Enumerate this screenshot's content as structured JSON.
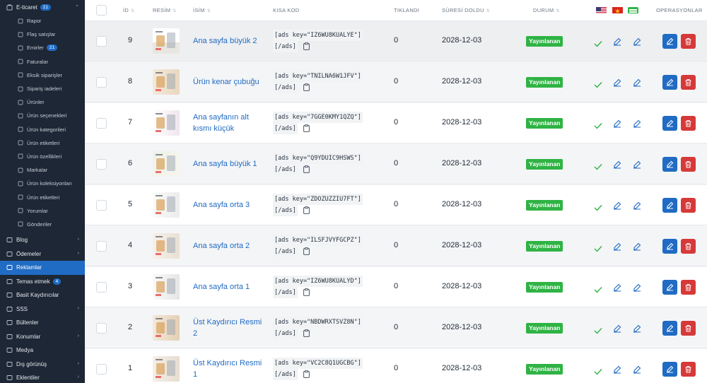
{
  "sidebar": {
    "top": {
      "label": "E-ticaret",
      "badge": "21"
    },
    "children": [
      {
        "label": "Rapor",
        "icon": "report-icon"
      },
      {
        "label": "Flaş satışlar",
        "icon": "flash-icon"
      },
      {
        "label": "Emirler",
        "icon": "orders-icon",
        "badge": "21"
      },
      {
        "label": "Faturalar",
        "icon": "invoice-icon"
      },
      {
        "label": "Eksik siparişler",
        "icon": "cart-icon"
      },
      {
        "label": "Sipariş iadeleri",
        "icon": "return-icon"
      },
      {
        "label": "Ürünler",
        "icon": "box-icon"
      },
      {
        "label": "Ürün seçenekleri",
        "icon": "options-icon"
      },
      {
        "label": "Ürün kategorileri",
        "icon": "category-icon"
      },
      {
        "label": "Ürün etiketleri",
        "icon": "tag-icon"
      },
      {
        "label": "Ürün özellikleri",
        "icon": "attributes-icon"
      },
      {
        "label": "Markalar",
        "icon": "brand-icon"
      },
      {
        "label": "Ürün koleksiyonları",
        "icon": "collection-icon"
      },
      {
        "label": "Ürün etiketleri",
        "icon": "label-icon"
      },
      {
        "label": "Yorumlar",
        "icon": "star-icon"
      },
      {
        "label": "Gönderiler",
        "icon": "shipment-icon"
      }
    ],
    "parents": [
      {
        "label": "Blog",
        "icon": "blog-icon",
        "chevron": "›"
      },
      {
        "label": "Ödemeler",
        "icon": "payment-icon",
        "chevron": "›"
      },
      {
        "label": "Reklamlar",
        "icon": "ads-icon",
        "chevron": "",
        "active": true
      },
      {
        "label": "Temas etmek",
        "icon": "mail-icon",
        "badge": "4",
        "chevron": ""
      },
      {
        "label": "Basit Kaydırıcılar",
        "icon": "slider-icon",
        "chevron": ""
      },
      {
        "label": "SSS",
        "icon": "faq-icon",
        "chevron": "›"
      },
      {
        "label": "Bültenler",
        "icon": "newsletter-icon",
        "chevron": ""
      },
      {
        "label": "Konumlar",
        "icon": "location-icon",
        "chevron": "›"
      },
      {
        "label": "Medya",
        "icon": "folder-icon",
        "chevron": ""
      },
      {
        "label": "Dış görünüş",
        "icon": "appearance-icon",
        "chevron": "›"
      },
      {
        "label": "Eklentiler",
        "icon": "plugin-icon",
        "chevron": "›"
      }
    ]
  },
  "table": {
    "headers": {
      "id": "İD",
      "image": "RESİM",
      "name": "İSİM",
      "shortcode": "KISA KOD",
      "clicked": "TIKLANDI",
      "expired": "SÜRESİ DOLDU",
      "status": "DURUM",
      "operations": "OPERASYONLAR"
    },
    "flags": [
      "us-flag-icon",
      "vn-flag-icon",
      "language-badge-icon"
    ],
    "code_close": "[/ads]",
    "rows": [
      {
        "id": "9",
        "name": "Ana sayfa büyük 2",
        "code": "[ads key=\"IZ6WU8KUALYE\"]",
        "clicked": "0",
        "expired": "2028-12-03",
        "status": "Yayınlanan"
      },
      {
        "id": "8",
        "name": "Ürün kenar çubuğu",
        "code": "[ads key=\"TNILNA6W1JFV\"]",
        "clicked": "0",
        "expired": "2028-12-03",
        "status": "Yayınlanan"
      },
      {
        "id": "7",
        "name": "Ana sayfanın alt kısmı küçük",
        "code": "[ads key=\"7GGE0KMY1QZQ\"]",
        "clicked": "0",
        "expired": "2028-12-03",
        "status": "Yayınlanan"
      },
      {
        "id": "6",
        "name": "Ana sayfa büyük 1",
        "code": "[ads key=\"Q9YDUIC9HSWS\"]",
        "clicked": "0",
        "expired": "2028-12-03",
        "status": "Yayınlanan"
      },
      {
        "id": "5",
        "name": "Ana sayfa orta 3",
        "code": "[ads key=\"ZDOZUZZIU7FT\"]",
        "clicked": "0",
        "expired": "2028-12-03",
        "status": "Yayınlanan"
      },
      {
        "id": "4",
        "name": "Ana sayfa orta 2",
        "code": "[ads key=\"ILSFJVYFGCPZ\"]",
        "clicked": "0",
        "expired": "2028-12-03",
        "status": "Yayınlanan"
      },
      {
        "id": "3",
        "name": "Ana sayfa orta 1",
        "code": "[ads key=\"IZ6WU8KUALYD\"]",
        "clicked": "0",
        "expired": "2028-12-03",
        "status": "Yayınlanan"
      },
      {
        "id": "2",
        "name": "Üst Kaydırıcı Resmi 2",
        "code": "[ads key=\"NBDWRXTSVZ8N\"]",
        "clicked": "0",
        "expired": "2028-12-03",
        "status": "Yayınlanan"
      },
      {
        "id": "1",
        "name": "Üst Kaydırıcı Resmi 1",
        "code": "[ads key=\"VC2C8Q1UGCBG\"]",
        "clicked": "0",
        "expired": "2028-12-03",
        "status": "Yayınlanan"
      }
    ]
  },
  "colors": {
    "primary": "#206bc4",
    "success": "#2fb344",
    "danger": "#d63939",
    "sidebar": "#1d2735"
  }
}
